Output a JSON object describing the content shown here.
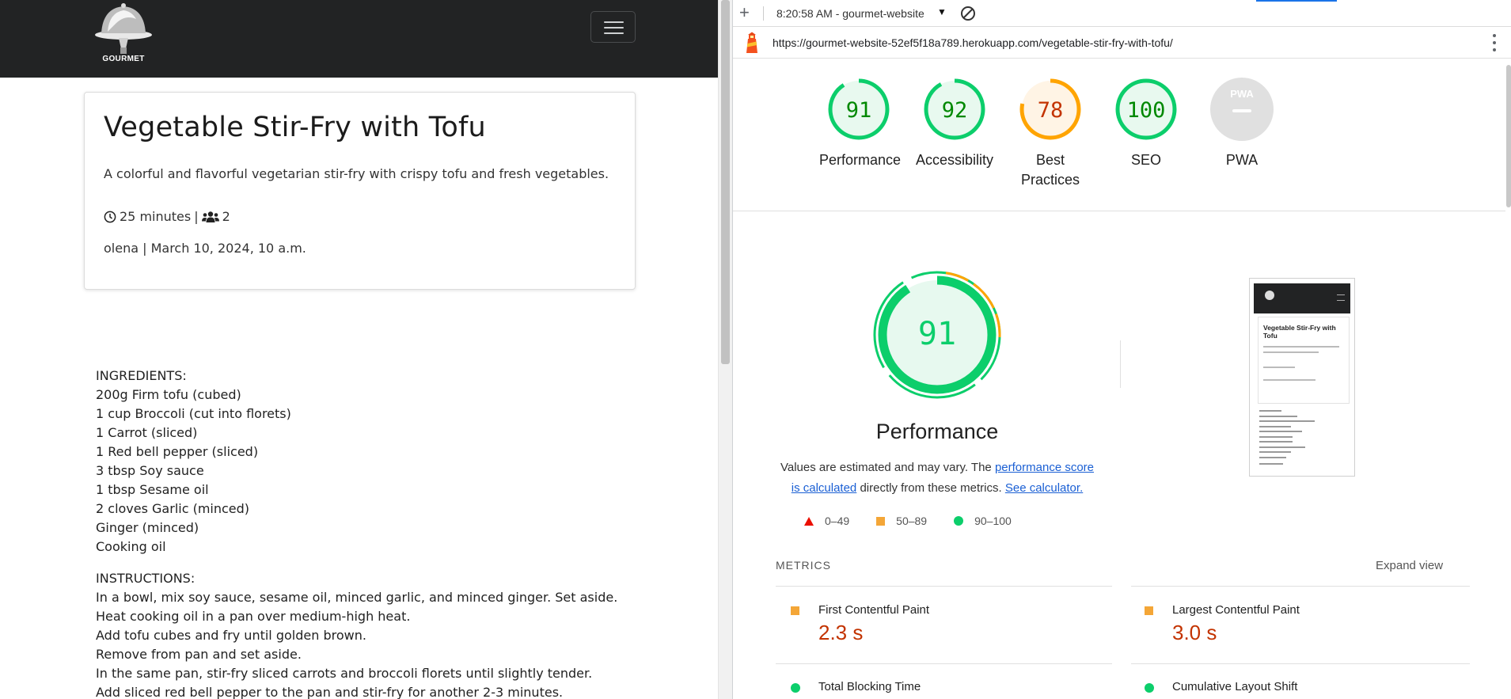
{
  "site": {
    "logo_text": "GOURMET",
    "recipe": {
      "title": "Vegetable Stir-Fry with Tofu",
      "description": "A colorful and flavorful vegetarian stir-fry with crispy tofu and fresh vegetables.",
      "time": "25 minutes",
      "separator": "|",
      "servings": "2",
      "author_line": "olena | March 10, 2024, 10 a.m."
    },
    "ingredients_heading": "INGREDIENTS:",
    "ingredients": [
      "200g Firm tofu (cubed)",
      "1 cup Broccoli (cut into florets)",
      "1 Carrot (sliced)",
      "1 Red bell pepper (sliced)",
      "3 tbsp Soy sauce",
      "1 tbsp Sesame oil",
      "2 cloves Garlic (minced)",
      "Ginger (minced)",
      "Cooking oil"
    ],
    "instructions_heading": "INSTRUCTIONS:",
    "instructions": [
      "In a bowl, mix soy sauce, sesame oil, minced garlic, and minced ginger. Set aside.",
      "Heat cooking oil in a pan over medium-high heat.",
      "Add tofu cubes and fry until golden brown.",
      "Remove from pan and set aside.",
      "In the same pan, stir-fry sliced carrots and broccoli florets until slightly tender.",
      "Add sliced red bell pepper to the pan and stir-fry for another 2-3 minutes."
    ]
  },
  "devtools": {
    "add_icon": "+",
    "report_select": "8:20:58 AM - gourmet-website",
    "url": "https://gourmet-website-52ef5f18a789.herokuapp.com/vegetable-stir-fry-with-tofu/",
    "scores": [
      {
        "label": "Performance",
        "score": "91",
        "value": 91,
        "status": "pass"
      },
      {
        "label": "Accessibility",
        "score": "92",
        "value": 92,
        "status": "pass"
      },
      {
        "label": "Best Practices",
        "score": "78",
        "value": 78,
        "status": "average"
      },
      {
        "label": "SEO",
        "score": "100",
        "value": 100,
        "status": "pass"
      },
      {
        "label": "PWA",
        "score": "PWA",
        "value": null,
        "status": "na"
      }
    ],
    "performance": {
      "score": "91",
      "label": "Performance",
      "note_prefix": "Values are estimated and may vary. The",
      "note_link1": "performance score is calculated",
      "note_middle": "directly from these metrics.",
      "note_link2": "See calculator."
    },
    "legend": [
      {
        "range": "0–49",
        "shape": "triangle",
        "color": "#eb0f00"
      },
      {
        "range": "50–89",
        "shape": "square",
        "color": "#f4a637"
      },
      {
        "range": "90–100",
        "shape": "circle",
        "color": "#0cce6b"
      }
    ],
    "thumbnail": {
      "title": "Vegetable Stir-Fry with Tofu"
    },
    "metrics_title": "METRICS",
    "expand_view": "Expand view",
    "metrics": [
      {
        "name": "First Contentful Paint",
        "value": "2.3 s",
        "status": "average"
      },
      {
        "name": "Largest Contentful Paint",
        "value": "3.0 s",
        "status": "average"
      },
      {
        "name": "Total Blocking Time",
        "value": "",
        "status": "pass"
      },
      {
        "name": "Cumulative Layout Shift",
        "value": "",
        "status": "pass"
      }
    ],
    "colors": {
      "pass": "#0cce6b",
      "average": "#ffa400",
      "fail": "#ff4e42",
      "pass_text": "#008800",
      "average_text": "#c33300"
    }
  }
}
